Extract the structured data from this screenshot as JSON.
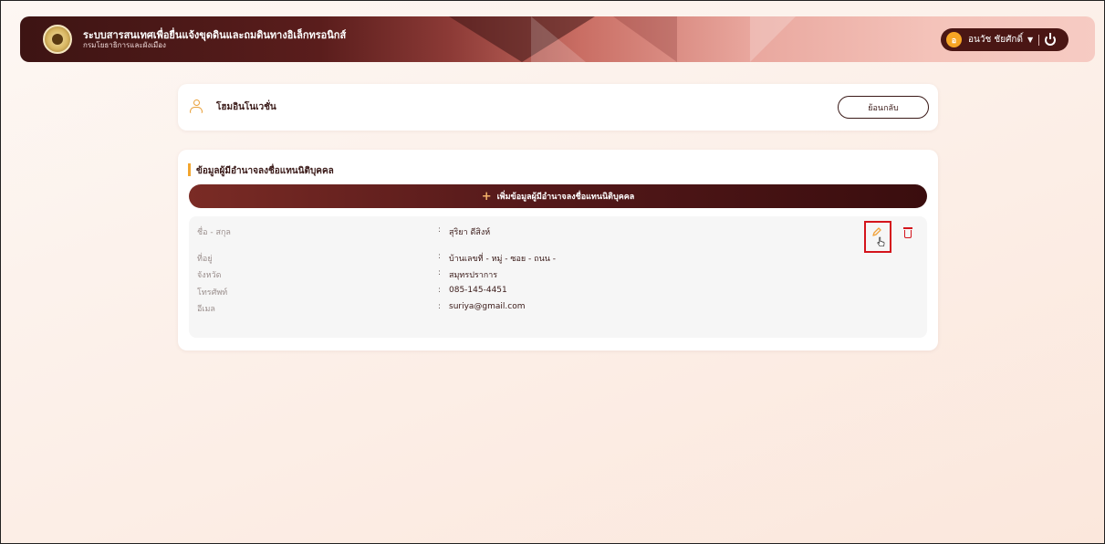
{
  "header": {
    "system_title": "ระบบสารสนเทศเพื่อยื่นแจ้งขุดดินและถมดินทางอิเล็กทรอนิกส์",
    "department": "กรมโยธาธิการและผังเมือง",
    "user": {
      "initial": "อ",
      "name": "อนวัช ชัยศักดิ์"
    },
    "colors": {
      "dark": "#3d1413",
      "light": "#f6cbc3",
      "avatar": "#f6a524"
    }
  },
  "company_card": {
    "name": "โฮมอินโนเวชั่น",
    "back_label": "ย้อนกลับ"
  },
  "signatory_section": {
    "title": "ข้อมูลผู้มีอำนาจลงชื่อแทนนิติบุคคล",
    "add_label": "เพิ่มข้อมูลผู้มีอำนาจลงชื่อแทนนิติบุคคล",
    "records": [
      {
        "rows": [
          {
            "label": "ชื่อ - สกุล",
            "value": "สุริยา ดีสิงห์"
          },
          {
            "label": "ที่อยู่",
            "value": "บ้านเลขที่ - หมู่ - ซอย - ถนน -"
          },
          {
            "label": "จังหวัด",
            "value": "สมุทรปราการ"
          },
          {
            "label": "โทรศัพท์",
            "value": "085-145-4451"
          },
          {
            "label": "อีเมล",
            "value": "suriya@gmail.com"
          }
        ],
        "colon": ":"
      }
    ],
    "colors": {
      "accent": "#f2a52f",
      "button_dark": "#3a0d0e",
      "delete": "#d4141c"
    }
  }
}
